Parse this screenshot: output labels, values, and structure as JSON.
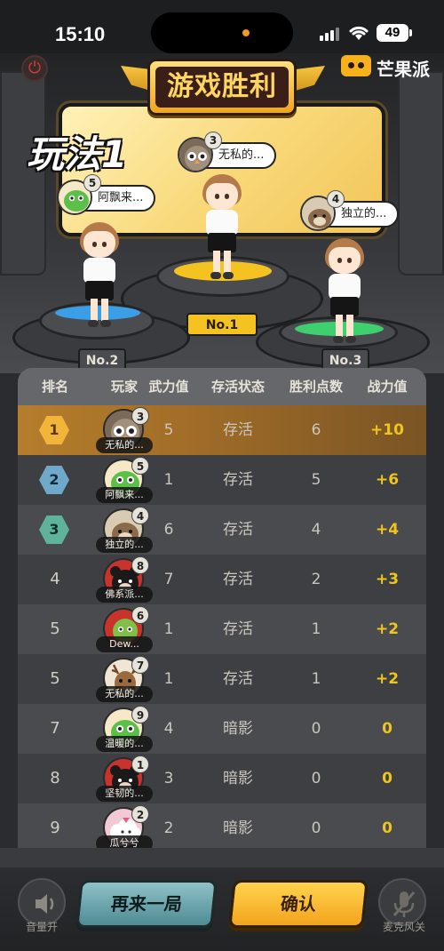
{
  "status_bar": {
    "time": "15:10",
    "battery": "49"
  },
  "brand": {
    "name": "芒果派"
  },
  "title": "游戏胜利",
  "mode_label": "玩法1",
  "podium": {
    "first": {
      "label": "No.1",
      "player_number": "3",
      "player_name": "无私的..."
    },
    "second": {
      "label": "No.2",
      "player_number": "5",
      "player_name": "阿飘来..."
    },
    "third": {
      "label": "No.3",
      "player_number": "4",
      "player_name": "独立的..."
    }
  },
  "table": {
    "headers": [
      "排名",
      "玩家",
      "武力值",
      "存活状态",
      "胜利点数",
      "战力值"
    ],
    "rows": [
      {
        "rank": "1",
        "number": "3",
        "name": "无私的...",
        "avatar_icon": "owl-avatar",
        "force": "5",
        "status": "存活",
        "points": "6",
        "power": "+10"
      },
      {
        "rank": "2",
        "number": "5",
        "name": "阿飘来...",
        "avatar_icon": "dino-avatar",
        "force": "1",
        "status": "存活",
        "points": "5",
        "power": "+6"
      },
      {
        "rank": "3",
        "number": "4",
        "name": "独立的...",
        "avatar_icon": "otter-avatar",
        "force": "6",
        "status": "存活",
        "points": "4",
        "power": "+4"
      },
      {
        "rank": "4",
        "number": "8",
        "name": "佛系派...",
        "avatar_icon": "bear-avatar",
        "force": "7",
        "status": "存活",
        "points": "2",
        "power": "+3"
      },
      {
        "rank": "5",
        "number": "6",
        "name": "Dew...",
        "avatar_icon": "leaf-avatar",
        "force": "1",
        "status": "存活",
        "points": "1",
        "power": "+2"
      },
      {
        "rank": "5",
        "number": "7",
        "name": "无私的...",
        "avatar_icon": "deer-avatar",
        "force": "1",
        "status": "存活",
        "points": "1",
        "power": "+2"
      },
      {
        "rank": "7",
        "number": "9",
        "name": "温暖的...",
        "avatar_icon": "dino-avatar",
        "force": "4",
        "status": "暗影",
        "points": "0",
        "power": "0"
      },
      {
        "rank": "8",
        "number": "1",
        "name": "坚韧的...",
        "avatar_icon": "bear-avatar",
        "force": "3",
        "status": "暗影",
        "points": "0",
        "power": "0"
      },
      {
        "rank": "9",
        "number": "2",
        "name": "瓜兮兮",
        "avatar_icon": "cloud-avatar",
        "force": "2",
        "status": "暗影",
        "points": "0",
        "power": "0"
      }
    ]
  },
  "bottom": {
    "volume_label": "音量开",
    "replay_label": "再来一局",
    "confirm_label": "确认",
    "mic_label": "麦克风关"
  },
  "colors": {
    "accent_gold": "#f0c51b",
    "first_row": "#b57d2d",
    "rank1_badge": "#f2b53a",
    "rank2_badge": "#6fa8c8",
    "rank3_badge": "#5fb39a",
    "platform_first": "#f5c321",
    "platform_second": "#3a9fe6",
    "platform_third": "#3fcf6f"
  }
}
